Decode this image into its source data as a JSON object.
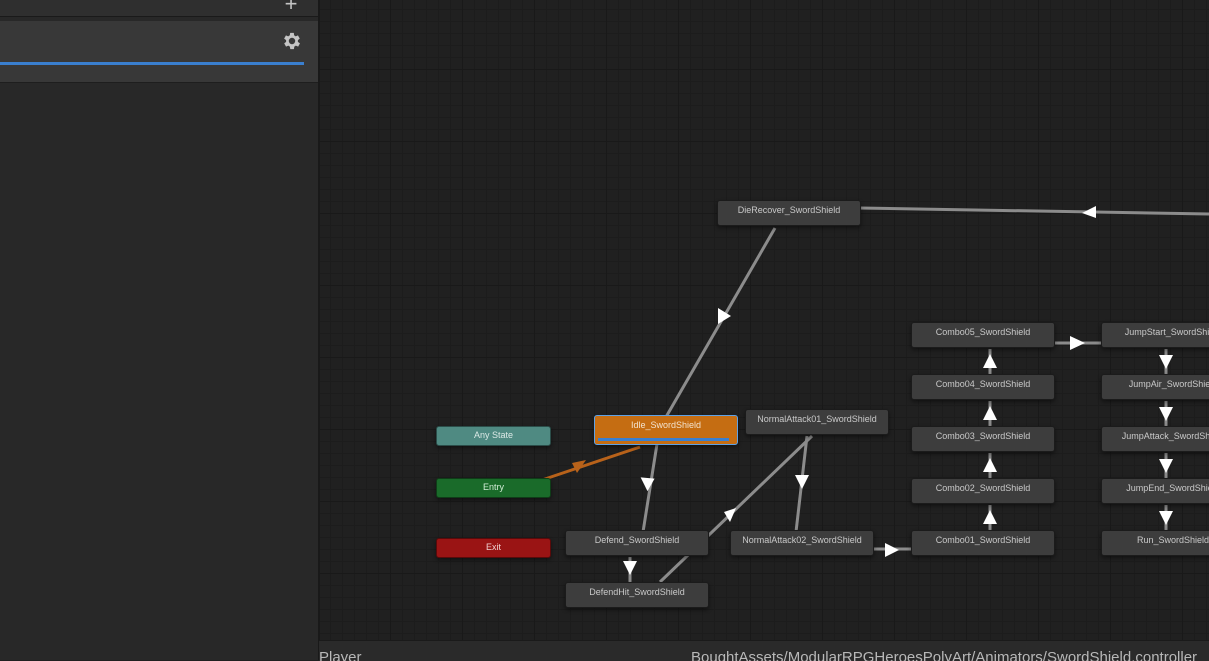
{
  "graph": {
    "states": [
      {
        "id": "die-recover",
        "label": "DieRecover_SwordShield"
      },
      {
        "id": "combo05",
        "label": "Combo05_SwordShield"
      },
      {
        "id": "combo04",
        "label": "Combo04_SwordShield"
      },
      {
        "id": "combo03",
        "label": "Combo03_SwordShield"
      },
      {
        "id": "combo02",
        "label": "Combo02_SwordShield"
      },
      {
        "id": "combo01",
        "label": "Combo01_SwordShield"
      },
      {
        "id": "jump-start",
        "label": "JumpStart_SwordShield"
      },
      {
        "id": "jump-air",
        "label": "JumpAir_SwordShield"
      },
      {
        "id": "jump-attack",
        "label": "JumpAttack_SwordShield"
      },
      {
        "id": "jump-end",
        "label": "JumpEnd_SwordShield"
      },
      {
        "id": "run",
        "label": "Run_SwordShield"
      },
      {
        "id": "idle",
        "label": "Idle_SwordShield"
      },
      {
        "id": "normal-attack-01",
        "label": "NormalAttack01_SwordShield"
      },
      {
        "id": "normal-attack-02",
        "label": "NormalAttack02_SwordShield"
      },
      {
        "id": "defend",
        "label": "Defend_SwordShield"
      },
      {
        "id": "defend-hit",
        "label": "DefendHit_SwordShield"
      }
    ],
    "any_state_label": "Any State",
    "entry_label": "Entry",
    "exit_label": "Exit"
  },
  "status_bar": {
    "layer": "Player",
    "path": "BoughtAssets/ModularRPGHeroesPolyArt/Animators/SwordShield.controller"
  },
  "colors": {
    "default_state": "#c56d12",
    "entry": "#1a6b2a",
    "exit": "#9a1414",
    "any_state": "#4f8a82",
    "selection": "#3a7fcf"
  }
}
